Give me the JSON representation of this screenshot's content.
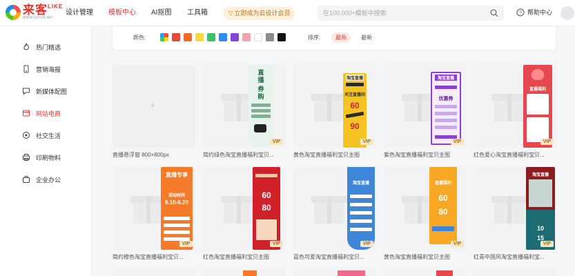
{
  "header": {
    "logo_cn": "来客",
    "logo_like": "LIKE",
    "logo_url": "WWW.SOYUN.NET",
    "nav": [
      "设计管理",
      "模板中心",
      "AI抠图",
      "工具箱"
    ],
    "vip_button": "立即成为云设计会员",
    "search_placeholder": "在100,000+模板中搜索",
    "help": "帮助中心"
  },
  "sidebar": {
    "items": [
      {
        "label": "热门精选",
        "icon": "flame-icon"
      },
      {
        "label": "营销海报",
        "icon": "phone-icon"
      },
      {
        "label": "新媒体配图",
        "icon": "chat-icon"
      },
      {
        "label": "网站电商",
        "icon": "cart-icon"
      },
      {
        "label": "社交生活",
        "icon": "share-icon"
      },
      {
        "label": "印刷物料",
        "icon": "print-icon"
      },
      {
        "label": "企业办公",
        "icon": "briefcase-icon"
      }
    ],
    "active_index": 3
  },
  "filter": {
    "color_label": "颜色:",
    "colors": [
      "#e34a3b",
      "#f06a2a",
      "#f5d93a",
      "#3bc26b",
      "#2f8cf3",
      "#8146d6",
      "#f0a3b0",
      "#ffffff",
      "#8c8c8c",
      "#111111"
    ],
    "sort_label": "排序:",
    "sort_options": [
      "最热",
      "最新"
    ],
    "active_sort": 0
  },
  "cards": [
    {
      "title": "直播悬浮窗 800×800px",
      "vip": ""
    },
    {
      "title": "简约绿色淘宝直播福利宝贝...",
      "vip": "VIP"
    },
    {
      "title": "黄色淘宝直播福利宝贝主图",
      "vip": "VIP"
    },
    {
      "title": "紫色淘宝直播福利宝贝主图",
      "vip": "VIP"
    },
    {
      "title": "红色爱心淘宝直播福利宝贝...",
      "vip": "VIP"
    },
    {
      "title": "简约橙色淘宝直播福利宝贝...",
      "vip": "VIP"
    },
    {
      "title": "红色淘宝直播福利宝贝主图",
      "vip": "VIP"
    },
    {
      "title": "蓝色可爱淘宝直播福利宝贝...",
      "vip": "VIP"
    },
    {
      "title": "黄色淘宝直播福利宝贝主图",
      "vip": "VIP"
    },
    {
      "title": "红青中国风淘宝直播福利宝...",
      "vip": "VIP"
    }
  ],
  "poster_text": {
    "p1": [
      "直",
      "播",
      "券",
      "购"
    ],
    "p2_top": "淘宝直播",
    "p2_big": [
      "60",
      "90"
    ],
    "p2_btn": "关注直播间",
    "p3_top": "淘宝直播",
    "p3_coupon": "优惠券",
    "p4_title": "直播福利",
    "p5_title": "直播专享",
    "p5_time_label": "活动时间",
    "p5_time": "6.10-6.20",
    "p6_big": [
      "60",
      "80"
    ],
    "p7_top": "淘宝直播",
    "p8_title": "直播福利",
    "p8_big": [
      "60",
      "80"
    ],
    "p9_top": "淘宝直播",
    "p9_big": [
      "10",
      "15"
    ]
  }
}
